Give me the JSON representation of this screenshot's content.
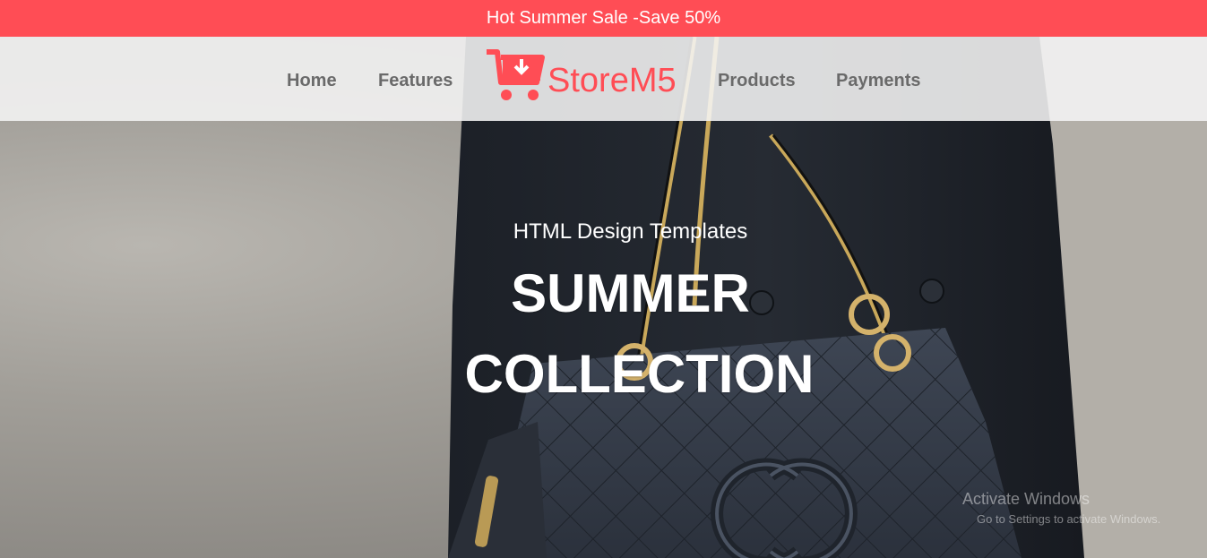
{
  "promo": {
    "text": "Hot Summer Sale -Save 50%"
  },
  "nav": {
    "home": "Home",
    "features": "Features",
    "products": "Products",
    "payments": "Payments"
  },
  "brand": {
    "name": "StoreM5",
    "icon": "cart-download-icon",
    "color": "#ff4d55"
  },
  "hero": {
    "subtitle": "HTML Design Templates",
    "title_line1": "SUMMER",
    "title_line2": "COLLECTION"
  },
  "watermark": {
    "line1": "Activate Windows",
    "line2": "Go to Settings to activate Windows."
  }
}
